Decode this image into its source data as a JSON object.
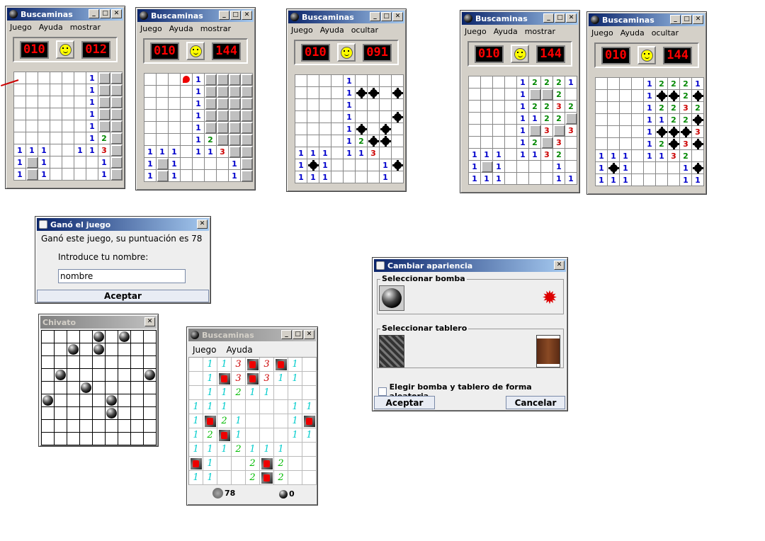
{
  "windows": [
    {
      "title": "Buscaminas",
      "menu": [
        "Juego",
        "Ayuda",
        "mostrar"
      ],
      "left": "010",
      "right": "012",
      "grid": [
        "......1CC",
        "......1CC",
        "......1CC",
        "......1CC",
        "......1CC",
        "......12C",
        "111..113C",
        "1C1....1C",
        "1C1....1C"
      ]
    },
    {
      "title": "Buscaminas",
      "menu": [
        "Juego",
        "Ayuda",
        "mostrar"
      ],
      "left": "010",
      "right": "144",
      "grid": [
        "...F1CCCC",
        "....1CCCC",
        "....1CCCC",
        "....1CCCC",
        "....1CCCC",
        "....12CCC",
        "111.113CC",
        "1C1....1C",
        "1C1....1C"
      ]
    },
    {
      "title": "Buscaminas",
      "menu": [
        "Juego",
        "Ayuda",
        "ocultar"
      ],
      "left": "010",
      "right": "091",
      "grid": [
        "....1....",
        "....1MM.M",
        "....1....",
        "....1...M",
        "....1M.M.",
        "....12MM.",
        "111.113..",
        "1M1....1M",
        "111....1."
      ]
    },
    {
      "title": "Buscaminas",
      "menu": [
        "Juego",
        "Ayuda",
        "mostrar"
      ],
      "left": "010",
      "right": "144",
      "grid": [
        "....12221",
        "....1CC2.",
        "....12232",
        "....1122C",
        "....1C3C3",
        "....12C3.",
        "111.1132.",
        "1C1....1.",
        "111....11"
      ]
    },
    {
      "title": "Buscaminas",
      "menu": [
        "Juego",
        "Ayuda",
        "ocultar"
      ],
      "left": "010",
      "right": "144",
      "grid": [
        "....12221",
        "....1MM2M",
        "....12232",
        "....1122M",
        "....1MMM3",
        "....12M3M",
        "111.1132.",
        "1M1....1M",
        "111....11"
      ]
    }
  ],
  "gano": {
    "title": "Ganó el juego",
    "message": "Ganó este juego, su puntuación es 78",
    "prompt": "Introduce tu nombre:",
    "value": "nombre",
    "button": "Aceptar"
  },
  "chivato": {
    "title": "Chivato",
    "bombs": [
      [
        0,
        4
      ],
      [
        0,
        6
      ],
      [
        1,
        2
      ],
      [
        1,
        4
      ],
      [
        3,
        1
      ],
      [
        3,
        8
      ],
      [
        4,
        3
      ],
      [
        5,
        0
      ],
      [
        5,
        5
      ],
      [
        6,
        5
      ]
    ]
  },
  "apariencia": {
    "title": "Cambiar apariencia",
    "bomb_label": "Seleccionar bomba",
    "board_label": "Seleccionar tablero",
    "random_label": "Elegir bomba y tablero de forma aleatoria",
    "ok": "Aceptar",
    "cancel": "Cancelar"
  },
  "themed": {
    "title": "Buscaminas",
    "menu": [
      "Juego",
      "Ayuda"
    ],
    "score": "78",
    "bombs": "0",
    "grid": [
      ".113F3F1.",
      ".1F3F311.",
      ".11211...",
      "111....11",
      "1F21...1F",
      "12F1...11",
      "1112111..",
      "F1..2F2..",
      "11..2F2.."
    ]
  }
}
